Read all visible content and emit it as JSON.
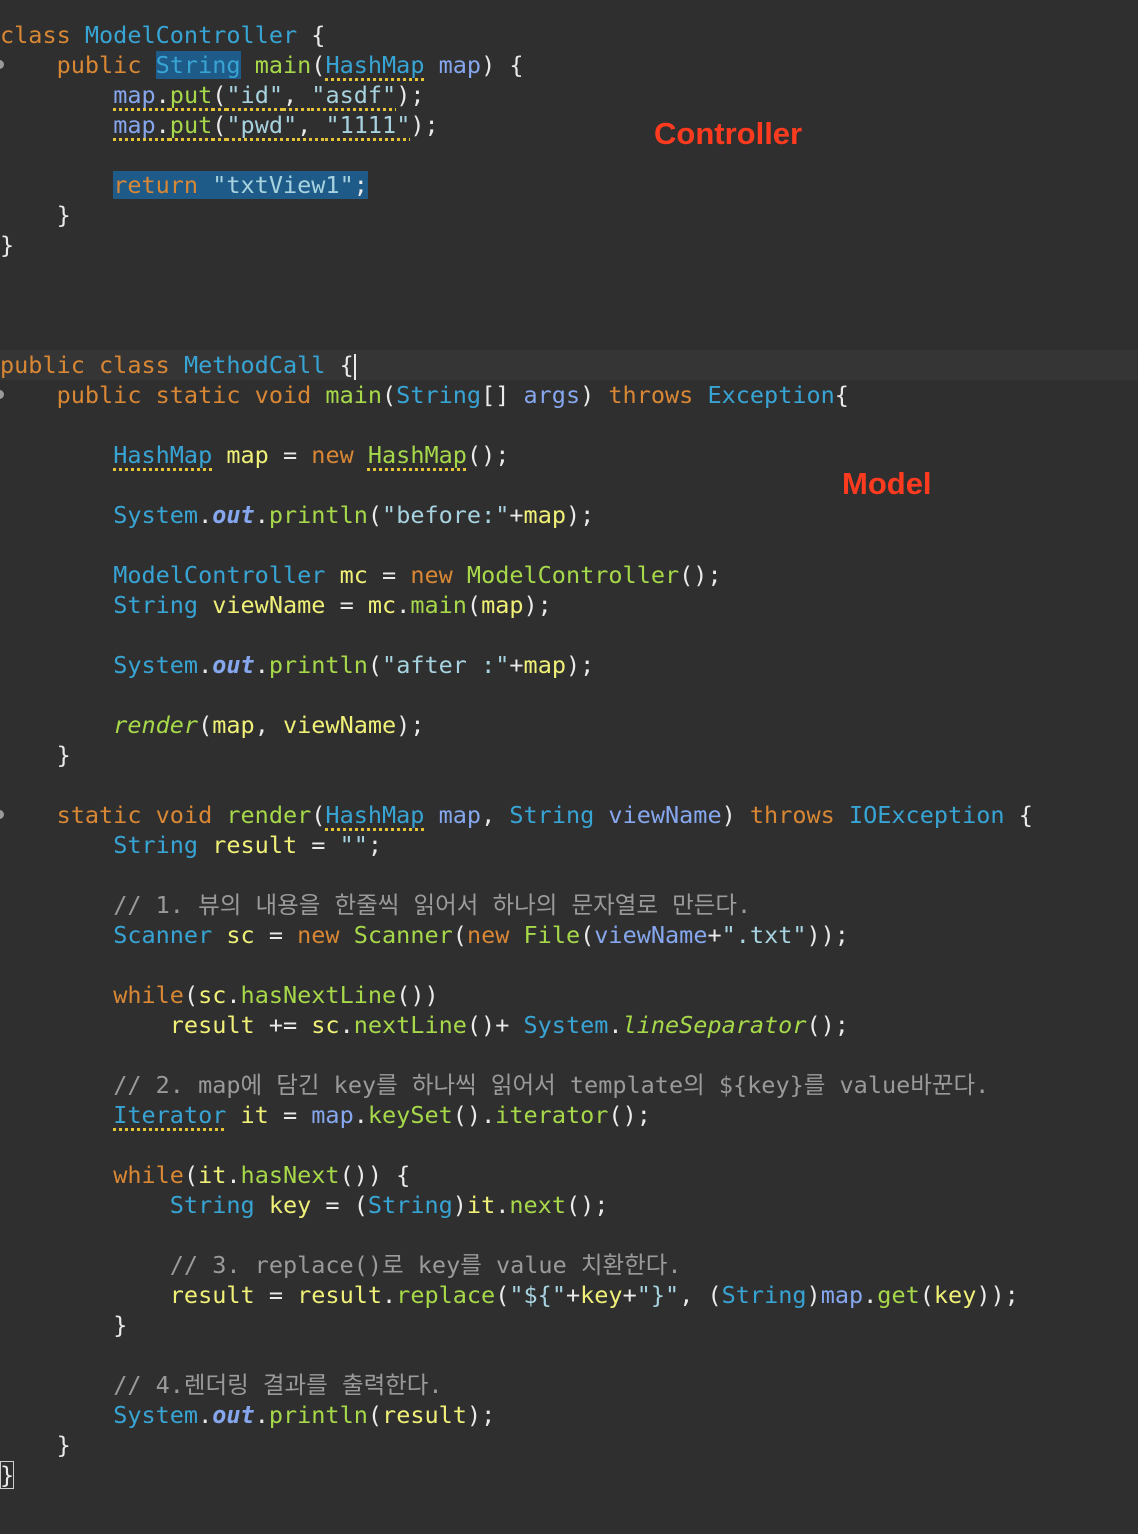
{
  "colors": {
    "background": "#2f2f2f",
    "keyword": "#d88735",
    "type": "#38a4d4",
    "function": "#a6d84a",
    "variable": "#f0f078",
    "parameter": "#86a7ee",
    "string": "#a7d2df",
    "comment": "#9a9a9a",
    "label": "#ff3b1f",
    "selection": "#1e5b88"
  },
  "labels": {
    "controller": "Controller",
    "model": "Model"
  },
  "code": [
    [
      [
        "kw",
        "class "
      ],
      [
        "typ",
        "ModelController"
      ],
      [
        "punc",
        " {"
      ]
    ],
    [
      [
        "dot",
        ""
      ],
      [
        "",
        "    "
      ],
      [
        "kw",
        "public "
      ],
      [
        "typ hl",
        "String"
      ],
      [
        "punc",
        " "
      ],
      [
        "fn",
        "main"
      ],
      [
        "punc",
        "("
      ],
      [
        "typ warn",
        "HashMap"
      ],
      [
        "punc",
        " "
      ],
      [
        "param",
        "map"
      ],
      [
        "punc",
        ") {"
      ]
    ],
    [
      [
        "",
        "        "
      ],
      [
        "param warn",
        "map"
      ],
      [
        "punc warn",
        "."
      ],
      [
        "fn warn",
        "put"
      ],
      [
        "punc warn",
        "("
      ],
      [
        "str warn",
        "\"id\""
      ],
      [
        "punc warn",
        ", "
      ],
      [
        "str warn",
        "\"asdf\""
      ],
      [
        "punc",
        ");"
      ]
    ],
    [
      [
        "",
        "        "
      ],
      [
        "param warn",
        "map"
      ],
      [
        "punc warn",
        "."
      ],
      [
        "fn warn",
        "put"
      ],
      [
        "punc warn",
        "("
      ],
      [
        "str warn",
        "\"pwd\""
      ],
      [
        "punc warn",
        ", "
      ],
      [
        "str warn",
        "\"1111\""
      ],
      [
        "punc",
        ");"
      ]
    ],
    [],
    [
      [
        "",
        "        "
      ],
      [
        "kw hl",
        "return "
      ],
      [
        "str hl",
        "\"txtView1\""
      ],
      [
        "punc hl",
        ";"
      ]
    ],
    [
      [
        "",
        "    "
      ],
      [
        "punc",
        "}"
      ]
    ],
    [
      [
        "punc",
        "}"
      ]
    ],
    [],
    [],
    [],
    [
      [
        "cur",
        ""
      ],
      [
        "kw",
        "public class "
      ],
      [
        "typ",
        "MethodCall"
      ],
      [
        "punc",
        " {"
      ],
      [
        "caret",
        ""
      ]
    ],
    [
      [
        "dot",
        ""
      ],
      [
        "",
        "    "
      ],
      [
        "kw",
        "public static void "
      ],
      [
        "fn",
        "main"
      ],
      [
        "punc",
        "("
      ],
      [
        "typ",
        "String"
      ],
      [
        "punc",
        "[] "
      ],
      [
        "param",
        "args"
      ],
      [
        "punc",
        ") "
      ],
      [
        "kw",
        "throws "
      ],
      [
        "typ",
        "Exception"
      ],
      [
        "punc",
        "{"
      ]
    ],
    [],
    [
      [
        "",
        "        "
      ],
      [
        "typ warn",
        "HashMap"
      ],
      [
        "punc",
        " "
      ],
      [
        "var",
        "map"
      ],
      [
        "punc",
        " = "
      ],
      [
        "kw",
        "new "
      ],
      [
        "fn warn",
        "HashMap"
      ],
      [
        "punc",
        "();"
      ]
    ],
    [],
    [
      [
        "",
        "        "
      ],
      [
        "typ",
        "System"
      ],
      [
        "punc",
        "."
      ],
      [
        "param bold ital",
        "out"
      ],
      [
        "punc",
        "."
      ],
      [
        "fn",
        "println"
      ],
      [
        "punc",
        "("
      ],
      [
        "str",
        "\"before:\""
      ],
      [
        "punc",
        "+"
      ],
      [
        "var",
        "map"
      ],
      [
        "punc",
        ");"
      ]
    ],
    [],
    [
      [
        "",
        "        "
      ],
      [
        "typ",
        "ModelController"
      ],
      [
        "punc",
        " "
      ],
      [
        "var",
        "mc"
      ],
      [
        "punc",
        " = "
      ],
      [
        "kw",
        "new "
      ],
      [
        "fn",
        "ModelController"
      ],
      [
        "punc",
        "();"
      ]
    ],
    [
      [
        "",
        "        "
      ],
      [
        "typ",
        "String"
      ],
      [
        "punc",
        " "
      ],
      [
        "var",
        "viewName"
      ],
      [
        "punc",
        " = "
      ],
      [
        "var",
        "mc"
      ],
      [
        "punc",
        "."
      ],
      [
        "fn",
        "main"
      ],
      [
        "punc",
        "("
      ],
      [
        "var",
        "map"
      ],
      [
        "punc",
        ");"
      ]
    ],
    [],
    [
      [
        "",
        "        "
      ],
      [
        "typ",
        "System"
      ],
      [
        "punc",
        "."
      ],
      [
        "param bold ital",
        "out"
      ],
      [
        "punc",
        "."
      ],
      [
        "fn",
        "println"
      ],
      [
        "punc",
        "("
      ],
      [
        "str",
        "\"after :\""
      ],
      [
        "punc",
        "+"
      ],
      [
        "var",
        "map"
      ],
      [
        "punc",
        ");"
      ]
    ],
    [],
    [
      [
        "",
        "        "
      ],
      [
        "fn ital",
        "render"
      ],
      [
        "punc",
        "("
      ],
      [
        "var",
        "map"
      ],
      [
        "punc",
        ", "
      ],
      [
        "var",
        "viewName"
      ],
      [
        "punc",
        ");"
      ]
    ],
    [
      [
        "",
        "    "
      ],
      [
        "punc",
        "}"
      ]
    ],
    [],
    [
      [
        "dot",
        ""
      ],
      [
        "",
        "    "
      ],
      [
        "kw",
        "static void "
      ],
      [
        "fn",
        "render"
      ],
      [
        "punc",
        "("
      ],
      [
        "typ warn",
        "HashMap"
      ],
      [
        "punc",
        " "
      ],
      [
        "param",
        "map"
      ],
      [
        "punc",
        ", "
      ],
      [
        "typ",
        "String"
      ],
      [
        "punc",
        " "
      ],
      [
        "param",
        "viewName"
      ],
      [
        "punc",
        ") "
      ],
      [
        "kw",
        "throws "
      ],
      [
        "typ",
        "IOException"
      ],
      [
        "punc",
        " {"
      ]
    ],
    [
      [
        "",
        "        "
      ],
      [
        "typ",
        "String"
      ],
      [
        "punc",
        " "
      ],
      [
        "var",
        "result"
      ],
      [
        "punc",
        " = "
      ],
      [
        "str",
        "\"\""
      ],
      [
        "punc",
        ";"
      ]
    ],
    [],
    [
      [
        "",
        "        "
      ],
      [
        "cmt",
        "// 1. 뷰의 내용을 한줄씩 읽어서 하나의 문자열로 만든다."
      ]
    ],
    [
      [
        "",
        "        "
      ],
      [
        "typ",
        "Scanner"
      ],
      [
        "punc",
        " "
      ],
      [
        "var",
        "sc"
      ],
      [
        "punc",
        " = "
      ],
      [
        "kw",
        "new "
      ],
      [
        "fn",
        "Scanner"
      ],
      [
        "punc",
        "("
      ],
      [
        "kw",
        "new "
      ],
      [
        "fn",
        "File"
      ],
      [
        "punc",
        "("
      ],
      [
        "param",
        "viewName"
      ],
      [
        "punc",
        "+"
      ],
      [
        "str",
        "\".txt\""
      ],
      [
        "punc",
        "));"
      ]
    ],
    [],
    [
      [
        "",
        "        "
      ],
      [
        "kw",
        "while"
      ],
      [
        "punc",
        "("
      ],
      [
        "var",
        "sc"
      ],
      [
        "punc",
        "."
      ],
      [
        "fn",
        "hasNextLine"
      ],
      [
        "punc",
        "())"
      ]
    ],
    [
      [
        "",
        "            "
      ],
      [
        "var",
        "result"
      ],
      [
        "punc",
        " += "
      ],
      [
        "var",
        "sc"
      ],
      [
        "punc",
        "."
      ],
      [
        "fn",
        "nextLine"
      ],
      [
        "punc",
        "()+ "
      ],
      [
        "typ",
        "System"
      ],
      [
        "punc",
        "."
      ],
      [
        "fn ital",
        "lineSeparator"
      ],
      [
        "punc",
        "();"
      ]
    ],
    [],
    [
      [
        "",
        "        "
      ],
      [
        "cmt",
        "// 2. map에 담긴 key를 하나씩 읽어서 template의 ${key}를 value바꾼다."
      ]
    ],
    [
      [
        "",
        "        "
      ],
      [
        "typ warn",
        "Iterator"
      ],
      [
        "punc",
        " "
      ],
      [
        "var",
        "it"
      ],
      [
        "punc",
        " = "
      ],
      [
        "param",
        "map"
      ],
      [
        "punc",
        "."
      ],
      [
        "fn",
        "keySet"
      ],
      [
        "punc",
        "()."
      ],
      [
        "fn",
        "iterator"
      ],
      [
        "punc",
        "();"
      ]
    ],
    [],
    [
      [
        "",
        "        "
      ],
      [
        "kw",
        "while"
      ],
      [
        "punc",
        "("
      ],
      [
        "var",
        "it"
      ],
      [
        "punc",
        "."
      ],
      [
        "fn",
        "hasNext"
      ],
      [
        "punc",
        "()) {"
      ]
    ],
    [
      [
        "",
        "            "
      ],
      [
        "typ",
        "String"
      ],
      [
        "punc",
        " "
      ],
      [
        "var",
        "key"
      ],
      [
        "punc",
        " = ("
      ],
      [
        "typ",
        "String"
      ],
      [
        "punc",
        ")"
      ],
      [
        "var",
        "it"
      ],
      [
        "punc",
        "."
      ],
      [
        "fn",
        "next"
      ],
      [
        "punc",
        "();"
      ]
    ],
    [],
    [
      [
        "",
        "            "
      ],
      [
        "cmt",
        "// 3. replace()로 key를 value 치환한다."
      ]
    ],
    [
      [
        "",
        "            "
      ],
      [
        "var",
        "result"
      ],
      [
        "punc",
        " = "
      ],
      [
        "var",
        "result"
      ],
      [
        "punc",
        "."
      ],
      [
        "fn",
        "replace"
      ],
      [
        "punc",
        "("
      ],
      [
        "str",
        "\"${\""
      ],
      [
        "punc",
        "+"
      ],
      [
        "var",
        "key"
      ],
      [
        "punc",
        "+"
      ],
      [
        "str",
        "\"}\""
      ],
      [
        "punc",
        ", ("
      ],
      [
        "typ",
        "String"
      ],
      [
        "punc",
        ")"
      ],
      [
        "param",
        "map"
      ],
      [
        "punc",
        "."
      ],
      [
        "fn",
        "get"
      ],
      [
        "punc",
        "("
      ],
      [
        "var",
        "key"
      ],
      [
        "punc",
        "));"
      ]
    ],
    [
      [
        "",
        "        "
      ],
      [
        "punc",
        "}"
      ]
    ],
    [],
    [
      [
        "",
        "        "
      ],
      [
        "cmt",
        "// 4.렌더링 결과를 출력한다."
      ]
    ],
    [
      [
        "",
        "        "
      ],
      [
        "typ",
        "System"
      ],
      [
        "punc",
        "."
      ],
      [
        "param bold ital",
        "out"
      ],
      [
        "punc",
        "."
      ],
      [
        "fn",
        "println"
      ],
      [
        "punc",
        "("
      ],
      [
        "var",
        "result"
      ],
      [
        "punc",
        ");"
      ]
    ],
    [
      [
        "",
        "    "
      ],
      [
        "punc",
        "}"
      ]
    ],
    [
      [
        "punc brace-box",
        "}"
      ]
    ]
  ]
}
